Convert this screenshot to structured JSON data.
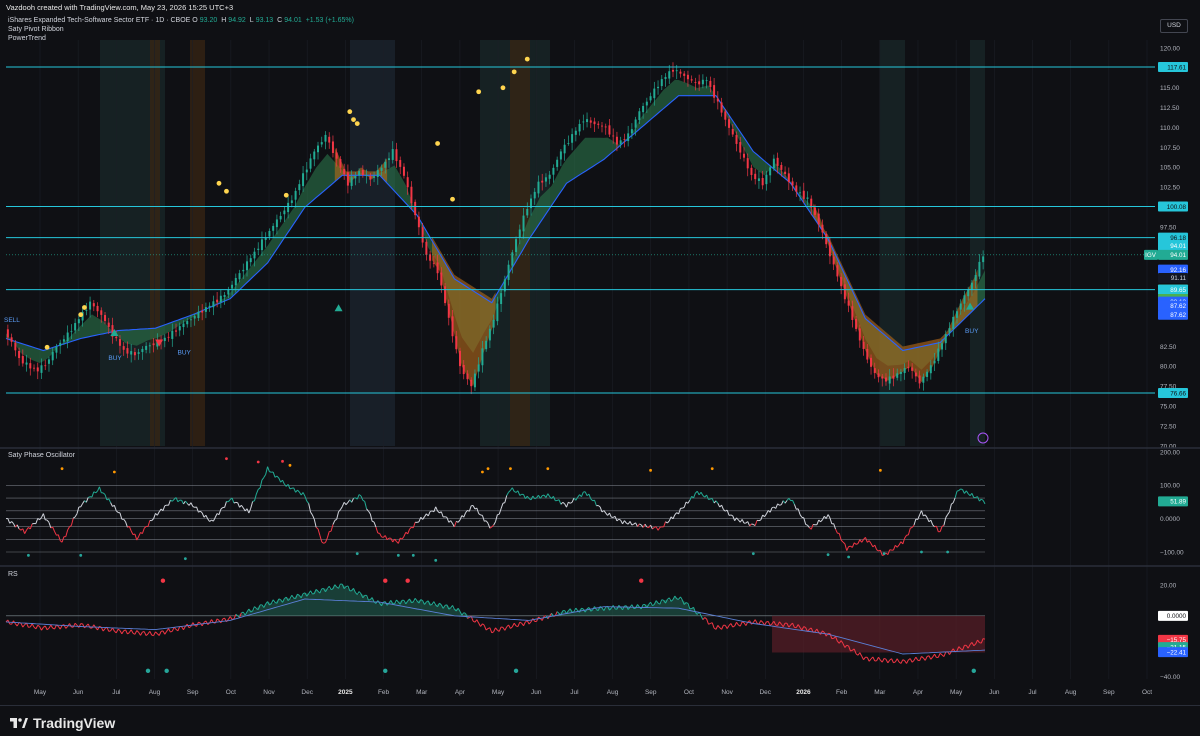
{
  "header": {
    "caption": "Vazdooh created with TradingView.com, May 23, 2026 15:25 UTC+3",
    "symbol": "iShares Expanded Tech-Software Sector ETF · 1D · CBOE",
    "o_label": "O",
    "o_value": "93.20",
    "h_label": "H",
    "h_value": "94.92",
    "l_label": "L",
    "l_value": "93.13",
    "c_label": "C",
    "c_value": "94.01",
    "change": "+1.53 (+1.65%)",
    "indicator_1": "Saty Pivot Ribbon",
    "indicator_2": "PowerTrend",
    "currency_button": "USD"
  },
  "osc_pane": {
    "title": "Saty Phase Oscillator"
  },
  "rs_pane": {
    "title": "RS"
  },
  "footer": {
    "brand": "TradingView"
  },
  "colors": {
    "background": "#0f1014",
    "grid": "#1c1f27",
    "cyan_level": "#26c6da",
    "bull": "#22ab94",
    "bear": "#f23645",
    "ema_blue": "#2962ff",
    "ribbon_green": "#2e7d4f",
    "ribbon_orange": "#b86d1a",
    "signal_yellow": "#ffd54f"
  },
  "chart_data": [
    {
      "type": "line",
      "title": "iShares Expanded Tech-Software Sector ETF · 1D · CBOE",
      "ylim": [
        70,
        121
      ],
      "y_ticks": [
        120,
        117.5,
        115,
        112.5,
        110,
        107.5,
        105,
        102.5,
        97.5,
        82.5,
        80,
        77.5,
        75,
        72.5,
        70
      ],
      "y_tick_labels": [
        "120.00",
        "117.50",
        "115.00",
        "112.50",
        "110.00",
        "107.50",
        "105.00",
        "102.50",
        "97.50",
        "82.50",
        "80.00",
        "77.50",
        "75.00",
        "72.50",
        "70.00"
      ],
      "x_ticks": [
        "May",
        "Jun",
        "Jul",
        "Aug",
        "Sep",
        "Oct",
        "Nov",
        "Dec",
        "2025",
        "Feb",
        "Mar",
        "Apr",
        "May",
        "Jun",
        "Jul",
        "Aug",
        "Sep",
        "Oct",
        "Nov",
        "Dec",
        "2026",
        "Feb",
        "Mar",
        "Apr",
        "May",
        "Jun",
        "Jul",
        "Aug",
        "Sep",
        "Oct"
      ],
      "x_tick_bold": [
        "2025",
        "2026"
      ],
      "price_series": {
        "name": "IGV",
        "t": [
          0,
          4,
          8,
          13,
          18,
          23,
          28,
          34,
          40,
          46,
          52,
          58,
          64,
          70,
          76,
          82,
          88,
          94,
          100,
          106,
          112,
          118,
          124,
          130,
          136,
          142,
          148,
          154,
          160,
          166,
          172,
          178,
          184,
          190,
          196,
          202,
          208,
          214,
          220,
          226,
          232,
          238,
          244,
          250,
          256,
          262,
          268,
          274,
          280,
          286,
          292,
          298,
          304,
          310,
          316,
          322,
          328,
          334,
          340,
          346,
          352,
          358,
          364,
          370,
          376,
          382,
          388,
          394,
          400,
          406,
          412,
          418,
          424,
          430,
          436,
          442,
          448,
          454,
          460,
          466,
          472,
          478,
          484,
          490,
          496,
          502,
          508,
          512,
          518,
          524
        ],
        "values": [
          84.5,
          83,
          81,
          80,
          79.5,
          80.5,
          82.5,
          84,
          86,
          88,
          86.5,
          84,
          82,
          81.5,
          82.5,
          83,
          83.8,
          85,
          86,
          87,
          88,
          89,
          91,
          93,
          95,
          97,
          99,
          101,
          104,
          107,
          109,
          106,
          103,
          104.5,
          103.5,
          105,
          107,
          104,
          99,
          94,
          92,
          86,
          80,
          77.5,
          82,
          86,
          91,
          96,
          100,
          103,
          104,
          107,
          109,
          111,
          110.5,
          110,
          108,
          109,
          112,
          114,
          116,
          117.3,
          116.5,
          115.5,
          116,
          113,
          110,
          107,
          104,
          103,
          106,
          104,
          102,
          101,
          98,
          94,
          90,
          86,
          82,
          79,
          78.2,
          79,
          80,
          78,
          80,
          83,
          86,
          88,
          90.5,
          94.01
        ]
      },
      "ema_series": {
        "name": "EMA",
        "t": [
          0,
          20,
          40,
          60,
          80,
          100,
          120,
          140,
          160,
          180,
          200,
          220,
          240,
          260,
          280,
          300,
          320,
          340,
          360,
          380,
          400,
          420,
          440,
          460,
          480,
          500,
          524
        ],
        "values": [
          83.5,
          82,
          83.5,
          84.5,
          84.8,
          86.5,
          88.5,
          93,
          100,
          104,
          104,
          99,
          91,
          88,
          96,
          103,
          106,
          110,
          114,
          114,
          107,
          103,
          96,
          86,
          82,
          83,
          88.5
        ]
      },
      "horizontal_levels": [
        117.61,
        100.08,
        96.18,
        89.65,
        76.66
      ],
      "level_labels": [
        "117.61",
        "100.08",
        "96.18",
        "89.65",
        "76.66"
      ],
      "price_tags": [
        {
          "value": 94.01,
          "label": "94.01",
          "color": "#26c6da"
        },
        {
          "value": 94.01,
          "label": "IGV",
          "color": "#22ab94"
        },
        {
          "value": 94.01,
          "label": "94.01",
          "color": "#22ab94"
        },
        {
          "value": 92.16,
          "label": "92.16",
          "color": "#2962ff"
        },
        {
          "value": 91.11,
          "label": "91.11",
          "color": "#131722"
        },
        {
          "value": 89.65,
          "label": "89.65",
          "color": "#4caf50"
        },
        {
          "value": 89.65,
          "label": "89.65",
          "color": "#26c6da"
        },
        {
          "value": 88.46,
          "label": "88.46",
          "color": "#4caf50"
        },
        {
          "value": 88.13,
          "label": "88.13",
          "color": "#2962ff"
        },
        {
          "value": 87.62,
          "label": "87.62",
          "color": "#2962ff"
        },
        {
          "value": 87.62,
          "label": "87.62",
          "color": "#2962ff"
        }
      ],
      "annotations": [
        "SELL",
        "BUY",
        "BUY",
        "BUY"
      ]
    },
    {
      "type": "line",
      "title": "Saty Phase Oscillator",
      "ylim": [
        -130,
        200
      ],
      "y_tick_labels": [
        "200.00",
        "100.00",
        "0.0000",
        "−100.00"
      ],
      "y_ticks": [
        200,
        100,
        0,
        -100
      ],
      "reference_levels": [
        100,
        61.8,
        23.6,
        0,
        -23.6,
        -61.8,
        -100
      ],
      "last_value": "51.89",
      "series": {
        "t": [
          0,
          10,
          20,
          30,
          40,
          50,
          60,
          70,
          80,
          90,
          100,
          110,
          120,
          130,
          140,
          150,
          160,
          170,
          180,
          190,
          200,
          210,
          220,
          230,
          240,
          250,
          260,
          270,
          280,
          290,
          300,
          310,
          320,
          330,
          340,
          350,
          360,
          370,
          380,
          390,
          400,
          410,
          420,
          430,
          440,
          450,
          460,
          470,
          480,
          490,
          500,
          510,
          524
        ],
        "values": [
          0,
          -40,
          10,
          -70,
          40,
          90,
          20,
          -60,
          10,
          60,
          40,
          -10,
          60,
          20,
          150,
          100,
          70,
          -80,
          40,
          70,
          -50,
          -70,
          -10,
          30,
          -20,
          40,
          -30,
          90,
          60,
          70,
          40,
          80,
          20,
          -10,
          -20,
          -30,
          20,
          80,
          50,
          0,
          -20,
          30,
          60,
          -30,
          10,
          -90,
          -60,
          -110,
          -70,
          20,
          -40,
          90,
          50
        ]
      }
    },
    {
      "type": "line",
      "title": "RS",
      "ylim": [
        -42,
        30
      ],
      "y_tick_labels": [
        "20.00",
        "0.0000",
        "−40.00"
      ],
      "y_ticks": [
        20,
        0,
        -40
      ],
      "value_tags": [
        {
          "value": 0,
          "label": "0.0000",
          "color": "#ffffff"
        },
        {
          "value": -15.75,
          "label": "−15.75",
          "color": "#f23645"
        },
        {
          "value": -21.15,
          "label": "−21.15",
          "color": "#22ab94"
        },
        {
          "value": -22.41,
          "label": "−22.41",
          "color": "#2962ff"
        }
      ],
      "series": {
        "t": [
          0,
          20,
          40,
          60,
          80,
          100,
          120,
          140,
          160,
          180,
          200,
          220,
          240,
          260,
          280,
          300,
          320,
          340,
          360,
          380,
          400,
          420,
          440,
          460,
          480,
          500,
          524
        ],
        "values": [
          -4,
          -8,
          -6,
          -10,
          -12,
          -6,
          -2,
          8,
          14,
          20,
          8,
          10,
          5,
          -10,
          -4,
          3,
          5,
          6,
          12,
          -8,
          -4,
          -6,
          -12,
          -28,
          -30,
          -26,
          -15.75
        ]
      },
      "ma_series": {
        "t": [
          0,
          40,
          80,
          120,
          160,
          200,
          240,
          280,
          320,
          360,
          400,
          440,
          480,
          524
        ],
        "values": [
          -4,
          -7,
          -9,
          -3,
          11,
          9,
          0,
          -3,
          6,
          5,
          -5,
          -12,
          -25,
          -22.41
        ]
      }
    }
  ]
}
